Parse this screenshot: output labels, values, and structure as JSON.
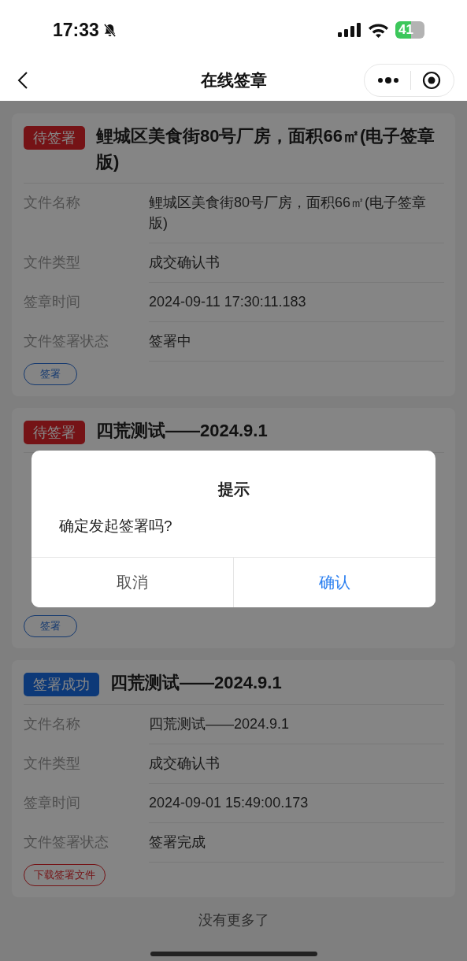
{
  "status_bar": {
    "time": "17:33",
    "battery": "41"
  },
  "nav": {
    "title": "在线签章"
  },
  "cards": [
    {
      "status": {
        "label": "待签署",
        "kind": "pending"
      },
      "title": "鲤城区美食街80号厂房，面积66㎡(电子签章版)",
      "fields": [
        {
          "label": "文件名称",
          "value": "鲤城区美食街80号厂房，面积66㎡(电子签章版)"
        },
        {
          "label": "文件类型",
          "value": "成交确认书"
        },
        {
          "label": "签章时间",
          "value": "2024-09-11 17:30:11.183"
        },
        {
          "label": "文件签署状态",
          "value": "签署中"
        }
      ],
      "action": {
        "label": "签署",
        "kind": "sign"
      }
    },
    {
      "status": {
        "label": "待签署",
        "kind": "pending"
      },
      "title": "四荒测试——2024.9.1",
      "action": {
        "label": "签署",
        "kind": "sign"
      }
    },
    {
      "status": {
        "label": "签署成功",
        "kind": "success"
      },
      "title": "四荒测试——2024.9.1",
      "fields": [
        {
          "label": "文件名称",
          "value": "四荒测试——2024.9.1"
        },
        {
          "label": "文件类型",
          "value": "成交确认书"
        },
        {
          "label": "签章时间",
          "value": "2024-09-01 15:49:00.173"
        },
        {
          "label": "文件签署状态",
          "value": "签署完成"
        }
      ],
      "action": {
        "label": "下载签署文件",
        "kind": "download"
      }
    }
  ],
  "footer": "没有更多了",
  "dialog": {
    "title": "提示",
    "message": "确定发起签署吗?",
    "buttons": [
      {
        "label": "取消",
        "kind": "cancel"
      },
      {
        "label": "确认",
        "kind": "confirm"
      }
    ]
  }
}
